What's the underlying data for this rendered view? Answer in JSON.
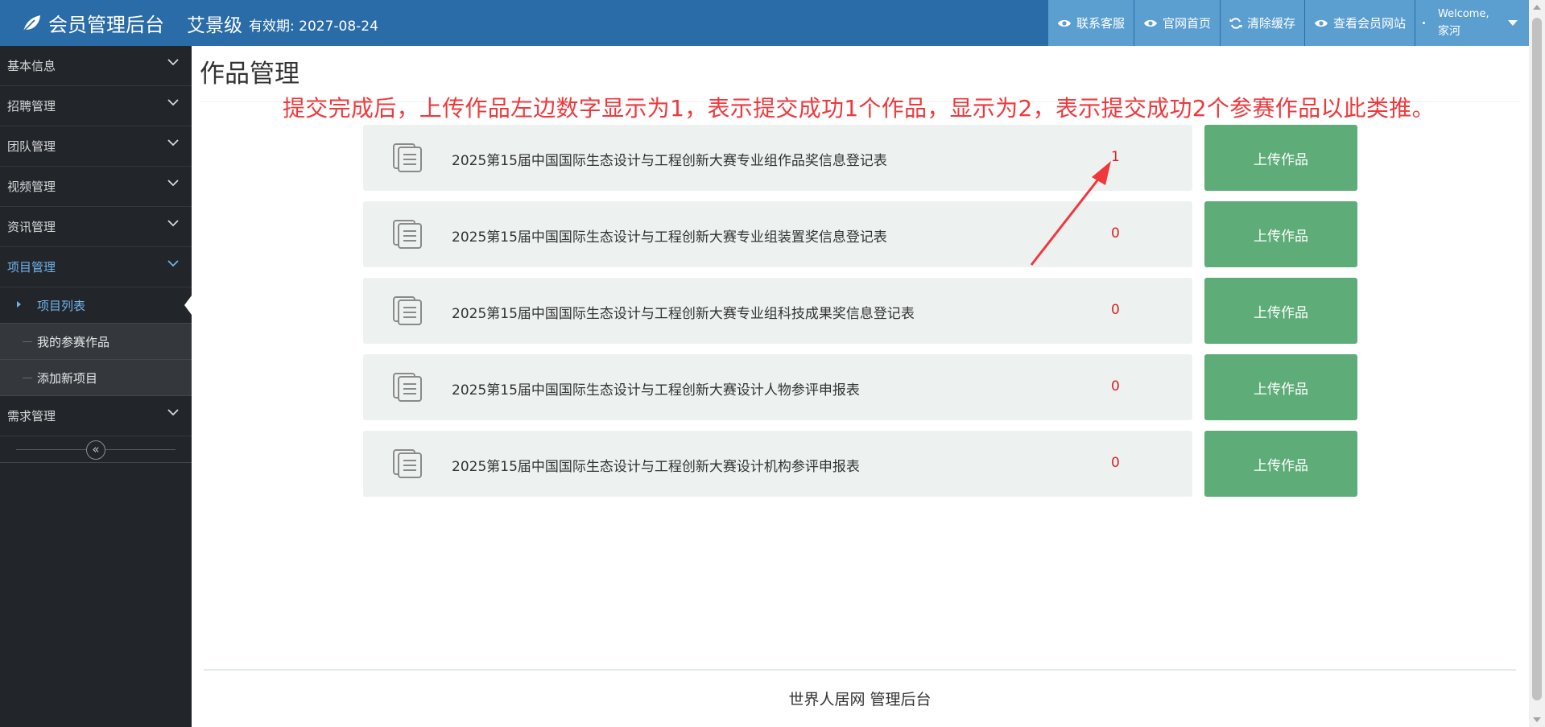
{
  "header": {
    "app_title": "会员管理后台",
    "user_name": "艾景级",
    "expiry": "有效期: 2027-08-24",
    "buttons": [
      {
        "label": "联系客服",
        "icon": "eye-icon"
      },
      {
        "label": "官网首页",
        "icon": "eye-icon"
      },
      {
        "label": "清除缓存",
        "icon": "refresh-icon"
      },
      {
        "label": "查看会员网站",
        "icon": "eye-icon"
      }
    ],
    "welcome_line1": "Welcome,",
    "welcome_line2": "家河"
  },
  "sidebar": {
    "items": [
      {
        "label": "基本信息"
      },
      {
        "label": "招聘管理"
      },
      {
        "label": "团队管理"
      },
      {
        "label": "视频管理"
      },
      {
        "label": "资讯管理"
      },
      {
        "label": "项目管理"
      },
      {
        "label": "需求管理"
      }
    ],
    "submenu": [
      {
        "label": "项目列表"
      },
      {
        "label": "我的参赛作品"
      },
      {
        "label": "添加新项目"
      }
    ],
    "collapse_icon": "«"
  },
  "main": {
    "title": "作品管理",
    "annotation": "提交完成后，上传作品左边数字显示为1，表示提交成功1个作品，显示为2，表示提交成功2个参赛作品以此类推。",
    "upload_label": "上传作品",
    "rows": [
      {
        "name": "2025第15届中国国际生态设计与工程创新大赛专业组作品奖信息登记表",
        "count": "1"
      },
      {
        "name": "2025第15届中国国际生态设计与工程创新大赛专业组装置奖信息登记表",
        "count": "0"
      },
      {
        "name": "2025第15届中国国际生态设计与工程创新大赛专业组科技成果奖信息登记表",
        "count": "0"
      },
      {
        "name": "2025第15届中国国际生态设计与工程创新大赛设计人物参评申报表",
        "count": "0"
      },
      {
        "name": "2025第15届中国国际生态设计与工程创新大赛设计机构参评申报表",
        "count": "0"
      }
    ]
  },
  "footer": {
    "text": "世界人居网 管理后台"
  },
  "colors": {
    "navbar": "#2a6ca7",
    "nav_button": "#5b9fd0",
    "sidebar": "#22262b",
    "upload_button": "#5ead79",
    "count": "#e02020",
    "annotation": "#f0383c"
  }
}
